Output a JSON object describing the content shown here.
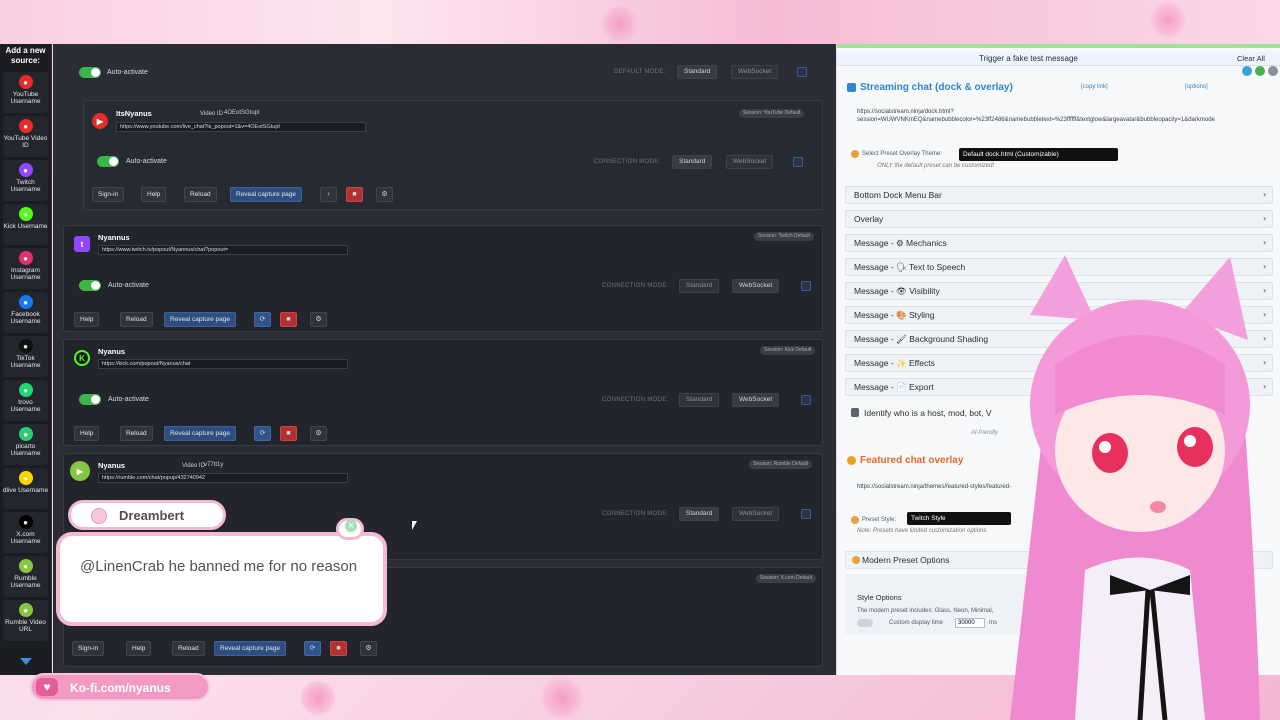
{
  "sidebar": {
    "title": "Add a new source:",
    "items": [
      {
        "label": "YouTube Username",
        "icon": "youtube-icon",
        "color": "#e52d27"
      },
      {
        "label": "YouTube Video ID",
        "icon": "youtube-icon",
        "color": "#e52d27"
      },
      {
        "label": "Twitch Username",
        "icon": "twitch-icon",
        "color": "#9146ff"
      },
      {
        "label": "Kick Username",
        "icon": "kick-icon",
        "color": "#53fc18"
      },
      {
        "label": "Instagram Username",
        "icon": "instagram-icon",
        "color": "#e1306c"
      },
      {
        "label": "Facebook Username",
        "icon": "facebook-icon",
        "color": "#1877f2"
      },
      {
        "label": "TikTok Username",
        "icon": "tiktok-icon",
        "color": "#111111"
      },
      {
        "label": "trovo Username",
        "icon": "trovo-icon",
        "color": "#1fd671"
      },
      {
        "label": "picarto Username",
        "icon": "picarto-icon",
        "color": "#2ecc71"
      },
      {
        "label": "dlive Username",
        "icon": "dlive-icon",
        "color": "#ffd300"
      },
      {
        "label": "X.com Username",
        "icon": "x-icon",
        "color": "#000000"
      },
      {
        "label": "Rumble Username",
        "icon": "rumble-icon",
        "color": "#85c742"
      },
      {
        "label": "Rumble Video URL",
        "icon": "rumble-icon",
        "color": "#85c742"
      }
    ]
  },
  "main": {
    "top_auto_activate": "Auto-activate",
    "top_default_mode": "DEFAULT MODE:",
    "mode_standard": "Standard",
    "mode_websocket": "WebSocket",
    "connection_mode": "CONNECTION MODE:",
    "btn_signin": "Sign-in",
    "btn_help": "Help",
    "btn_reload": "Reload",
    "btn_reveal": "Reveal capture page",
    "auto_activate": "Auto-activate",
    "video_id_label": "Video ID",
    "sources": [
      {
        "name": "ItsNyanus",
        "video_id": "4OEotSGtupI",
        "url": "https://www.youtube.com/live_chat?is_popout=1&v=4OEotSGtupI",
        "badge": "Session: YouTube Default"
      },
      {
        "name": "Nyannus",
        "url": "https://www.twitch.tv/popout/Nyannus/chat?popout=",
        "badge": "Session: Twitch Default"
      },
      {
        "name": "Nyanus",
        "url": "https://kick.com/popout/Nyanus/chat",
        "badge": "Session: Kick Default"
      },
      {
        "name": "Nyanus",
        "video_id": "v77tt1y",
        "url": "https://rumble.com/chat/popup/432740942",
        "badge": "Session: Rumble Default"
      },
      {
        "badge": "Session: X.com Default"
      }
    ]
  },
  "overlay_chat": {
    "author": "Dreambert",
    "message": "@LinenCrab he banned me for no reason"
  },
  "kofi": {
    "text": "Ko-fi.com/nyanus"
  },
  "right": {
    "fake_msg": "Trigger a fake test message",
    "clear_all": "Clear All",
    "streaming_title": "Streaming chat (dock & overlay)",
    "copy_link": "[copy link]",
    "options_link": "[options]",
    "dock_url": "https://socialstream.ninja/dock.html?session=WUWVNKmEQ&namebubblecolor=%23ff2486&namebubbletext=%23ffffff&textglow&largeavatar&bubbleopacity=1&darkmode",
    "preset_label": "Select Preset Overlay Theme:",
    "preset_value": "Default dock.html (Customizable)",
    "preset_note": "ONLY the default preset can be customized!",
    "menu": [
      "Bottom Dock Menu Bar",
      "Overlay",
      "Message - ⚙ Mechanics",
      "Message - 🗣 Text to Speech",
      "Message - 👁 Visibility",
      "Message - 🎨 Styling",
      "Message - 🖌 Background Shading",
      "Message - ✨ Effects",
      "Message - 📄 Export"
    ],
    "identify": "Identify who is a host, mod, bot, V",
    "ai_friendly": "AI-friendly",
    "featured_title": "Featured chat overlay",
    "featured_url": "https://socialstream.ninja/themes/featured-styles/featured-",
    "preset_style_label": "Preset Style:",
    "preset_style_value": "Twitch Style",
    "preset_style_note": "Note: Presets have limited customization options",
    "modern_title": "Modern Preset Options",
    "style_options": "Style Options",
    "modern_desc": "The modern preset includes: Glass, Neon, Minimal,",
    "custom_display_time": "Custom display time",
    "display_time_value": "30000",
    "ms": "ms"
  },
  "colors": {
    "accent_blue": "#2f86c9",
    "toggle_green": "#3cb54a",
    "danger_red": "#b23232",
    "bubble_pink": "#f6b9d4"
  }
}
